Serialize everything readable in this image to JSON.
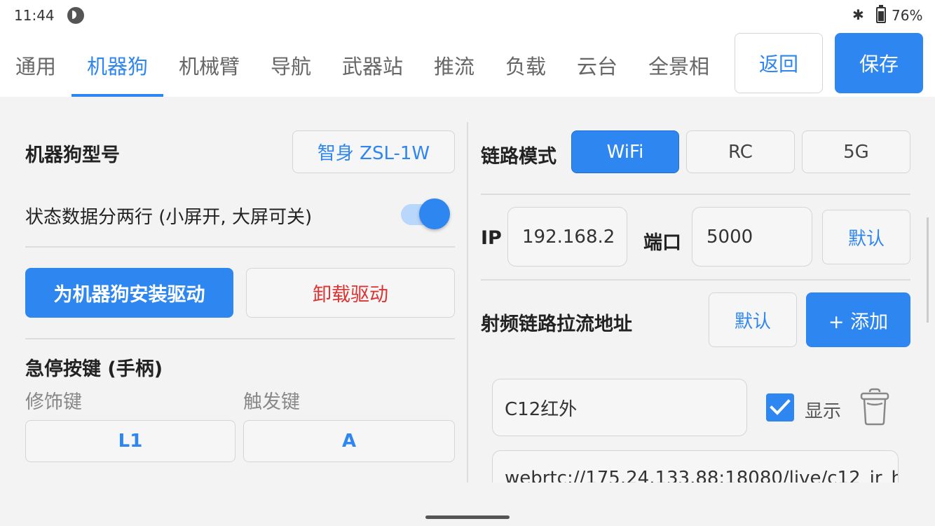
{
  "status_bar": {
    "time": "11:44",
    "battery": "76%",
    "bluetooth_icon": "bluetooth-icon",
    "battery_icon": "battery-charging-icon"
  },
  "tabs": [
    {
      "label": "通用",
      "active": false
    },
    {
      "label": "机器狗",
      "active": true
    },
    {
      "label": "机械臂",
      "active": false
    },
    {
      "label": "导航",
      "active": false
    },
    {
      "label": "武器站",
      "active": false
    },
    {
      "label": "推流",
      "active": false
    },
    {
      "label": "负载",
      "active": false
    },
    {
      "label": "云台",
      "active": false
    },
    {
      "label": "全景相",
      "active": false
    }
  ],
  "header": {
    "back_label": "返回",
    "save_label": "保存"
  },
  "left": {
    "model_label": "机器狗型号",
    "model_value": "智身 ZSL-1W",
    "two_line_label": "状态数据分两行 (小屏开, 大屏可关)",
    "two_line_on": true,
    "install_driver_label": "为机器狗安装驱动",
    "uninstall_driver_label": "卸载驱动",
    "estop_title": "急停按键 (手柄)",
    "modifier_label": "修饰键",
    "trigger_label": "触发键",
    "modifier_value": "L1",
    "trigger_value": "A"
  },
  "right": {
    "link_mode_label": "链路模式",
    "link_modes": [
      "WiFi",
      "RC",
      "5G"
    ],
    "link_mode_selected": "WiFi",
    "ip_label": "IP",
    "ip_value": "192.168.2",
    "port_label": "端口",
    "port_value": "5000",
    "default_label": "默认",
    "rf_stream_label": "射频链路拉流地址",
    "rf_default_label": "默认",
    "add_label": "+ 添加",
    "stream_name": "C12红外",
    "show_label": "显示",
    "show_checked": true,
    "stream_url": "webrtc://175.24.133.88:18080/live/c12_ir_h"
  },
  "colors": {
    "accent": "#2e86f0",
    "danger": "#d33333",
    "background": "#f3f3f3"
  }
}
